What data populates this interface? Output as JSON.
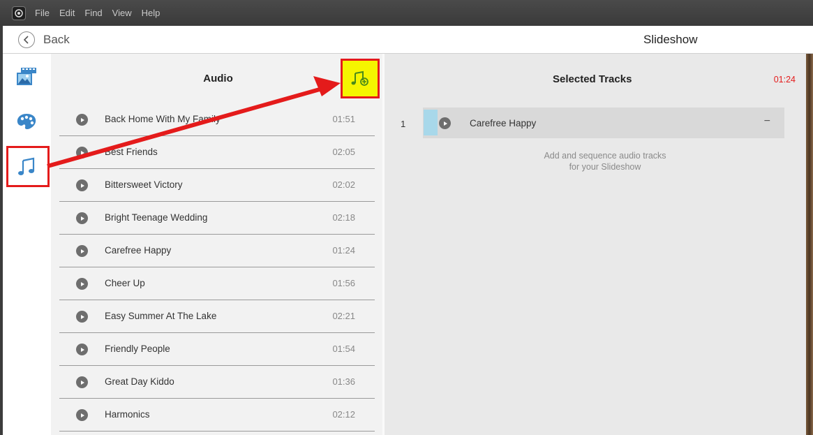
{
  "menubar": {
    "items": [
      "File",
      "Edit",
      "Find",
      "View",
      "Help"
    ]
  },
  "header": {
    "back_label": "Back",
    "title": "Slideshow"
  },
  "sidebar": {
    "items": [
      {
        "name": "media",
        "icon": "film-photo-icon"
      },
      {
        "name": "themes",
        "icon": "palette-icon"
      },
      {
        "name": "audio",
        "icon": "music-note-icon"
      }
    ]
  },
  "audio": {
    "title": "Audio",
    "add_button_icon": "add-music-icon",
    "tracks": [
      {
        "name": "Back Home With My Family",
        "duration": "01:51"
      },
      {
        "name": "Best Friends",
        "duration": "02:05"
      },
      {
        "name": "Bittersweet Victory",
        "duration": "02:02"
      },
      {
        "name": "Bright Teenage Wedding",
        "duration": "02:18"
      },
      {
        "name": "Carefree Happy",
        "duration": "01:24"
      },
      {
        "name": "Cheer Up",
        "duration": "01:56"
      },
      {
        "name": "Easy Summer At The Lake",
        "duration": "02:21"
      },
      {
        "name": "Friendly People",
        "duration": "01:54"
      },
      {
        "name": "Great Day Kiddo",
        "duration": "01:36"
      },
      {
        "name": "Harmonics",
        "duration": "02:12"
      }
    ]
  },
  "selected": {
    "title": "Selected Tracks",
    "total_duration": "01:24",
    "tracks": [
      {
        "index": "1",
        "name": "Carefree Happy"
      }
    ],
    "remove_label": "−",
    "hint_line1": "Add and sequence audio tracks",
    "hint_line2": "for your Slideshow"
  },
  "colors": {
    "accent_red": "#e41b1b",
    "highlight_yellow": "#f5f500",
    "icon_blue": "#3a86c8"
  }
}
